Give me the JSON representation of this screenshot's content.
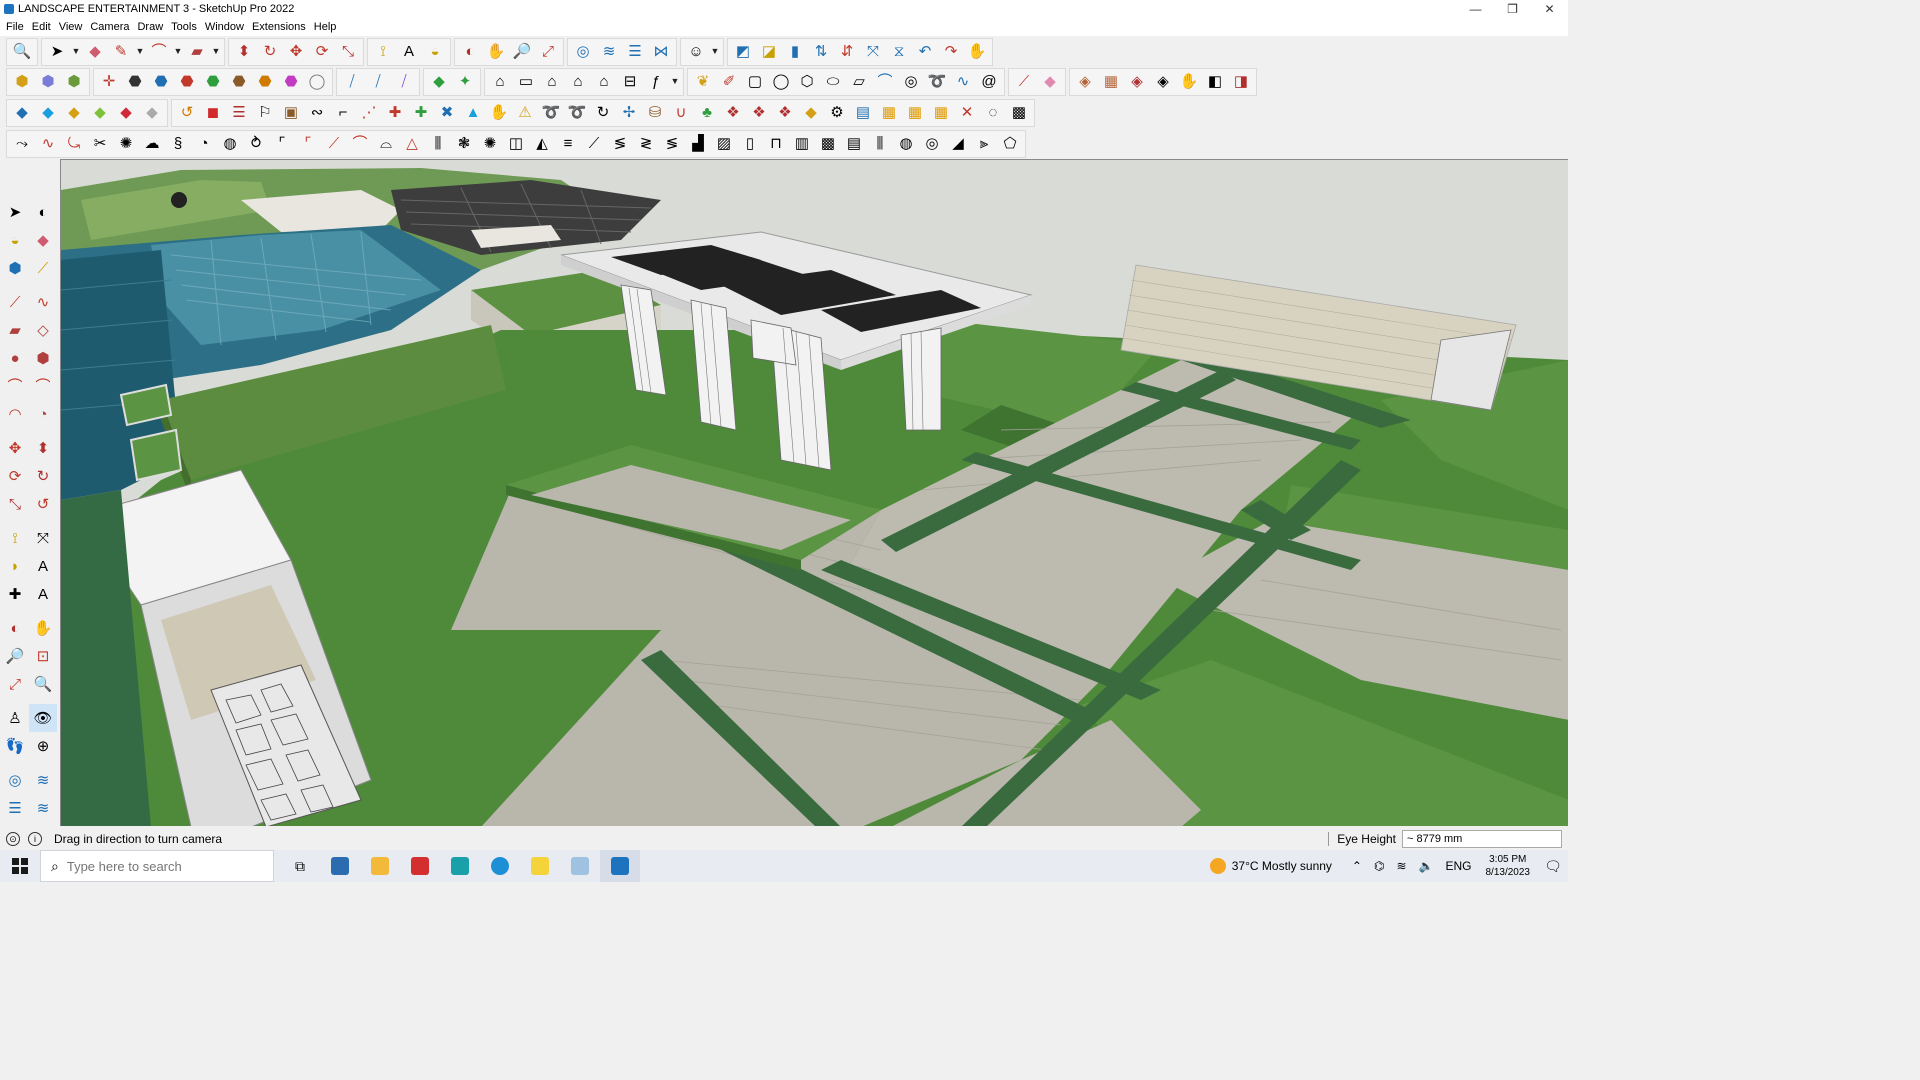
{
  "window": {
    "title": "LANDSCAPE ENTERTAINMENT 3 - SketchUp Pro 2022",
    "controls": [
      "—",
      "❐",
      "✕"
    ]
  },
  "menu": [
    "File",
    "Edit",
    "View",
    "Camera",
    "Draw",
    "Tools",
    "Window",
    "Extensions",
    "Help"
  ],
  "status": {
    "hint": "Drag in direction to turn camera",
    "measure_label": "Eye Height",
    "measure_value": "~ 8779 mm"
  },
  "taskbar": {
    "search_placeholder": "Type here to search",
    "weather": "37°C  Mostly sunny",
    "lang": "ENG",
    "time": "3:05 PM",
    "date": "8/13/2023"
  },
  "colors": {
    "grass": "#4f8a3a",
    "grass_dark": "#3f7430",
    "paving": "#b9b6ac",
    "path_strip": "#3a6b3e",
    "water": "#2c6f86",
    "pergola": "#e9e9e9",
    "sky": "#d9dbd6"
  }
}
